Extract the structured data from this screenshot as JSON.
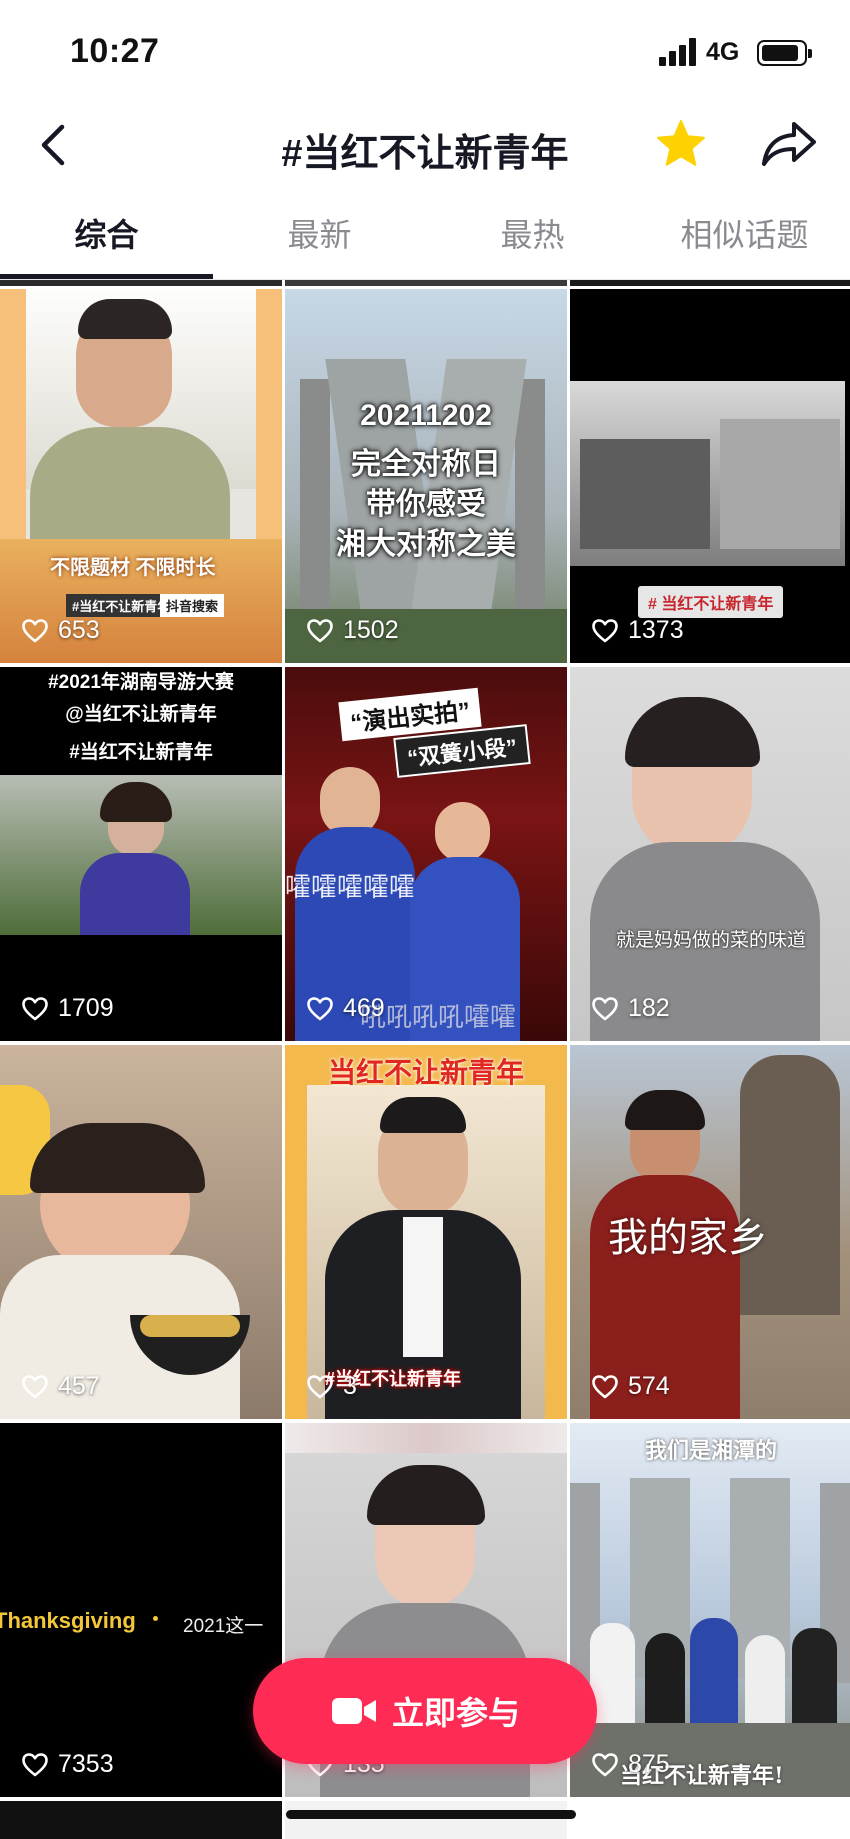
{
  "status": {
    "time": "10:27",
    "network": "4G"
  },
  "nav": {
    "title": "#当红不让新青年"
  },
  "tabs": [
    {
      "label": "综合",
      "active": true
    },
    {
      "label": "最新"
    },
    {
      "label": "最热"
    },
    {
      "label": "相似话题"
    }
  ],
  "videos": [
    {
      "likes": "653",
      "overlay": [
        "不限题材 不限时长",
        "#当红不让新青年",
        "抖音搜索"
      ]
    },
    {
      "likes": "1502",
      "overlay": [
        "20211202",
        "完全对称日",
        "带你感受",
        "湘大对称之美"
      ]
    },
    {
      "likes": "1373",
      "overlay": [
        "# 当红不让新青年"
      ]
    },
    {
      "likes": "1709",
      "overlay": [
        "#2021年湖南导游大赛",
        "@当红不让新青年",
        "#当红不让新青年"
      ]
    },
    {
      "likes": "469",
      "overlay": [
        "“演出实拍”",
        "“双簧小段”",
        "嚯嚯嚯嚯嚯",
        "吼吼吼吼嚯嚯"
      ]
    },
    {
      "likes": "182",
      "overlay": [
        "就是妈妈做的菜的味道"
      ]
    },
    {
      "likes": "457",
      "overlay": []
    },
    {
      "likes": "3",
      "overlay": [
        "当红不让新青年",
        "#当红不让新青年"
      ]
    },
    {
      "likes": "574",
      "overlay": [
        "我的家乡"
      ]
    },
    {
      "likes": "7353",
      "overlay": [
        "Thanksgiving",
        "2021这一"
      ]
    },
    {
      "likes": "135",
      "overlay": []
    },
    {
      "likes": "875",
      "overlay": [
        "我们是湘潭的",
        "当红不让新青年!"
      ]
    }
  ],
  "cta": {
    "label": "立即参与"
  },
  "colors": {
    "accent": "#fe2c55",
    "star": "#fdd200",
    "text": "#161823",
    "muted": "#8a8b91"
  },
  "icons": {
    "back": "chevron-left-icon",
    "favorite": "star-icon",
    "share": "share-icon",
    "like": "heart-icon",
    "camera": "video-camera-icon"
  }
}
